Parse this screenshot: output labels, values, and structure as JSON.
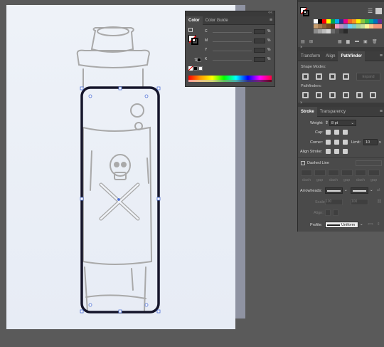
{
  "color_panel": {
    "tabs": [
      "Color",
      "Color Guide"
    ],
    "channels": [
      {
        "label": "C",
        "pct": "%"
      },
      {
        "label": "M",
        "pct": "%"
      },
      {
        "label": "Y",
        "pct": "%"
      },
      {
        "label": "K",
        "pct": "%"
      }
    ]
  },
  "swatches_panel": {
    "colors": [
      "#ffffff",
      "#000000",
      "#ff0000",
      "#ffff00",
      "#00a651",
      "#00aeef",
      "#2e3192",
      "#ec008c",
      "#f26522",
      "#f7941d",
      "#fff200",
      "#8dc63f",
      "#39b54a",
      "#00a99d",
      "#0072bc",
      "#662d91",
      "#c69c6d",
      "#a67c52",
      "#8c6239",
      "#754c24",
      "#603913",
      "#f49ac1",
      "#bd8cbf",
      "#8393ca",
      "#6dcff6",
      "#7accc8",
      "#a3d39c",
      "#c4df9b",
      "#fff799",
      "#fdc68a",
      "#f7977a",
      "#f69679"
    ]
  },
  "align_panel": {
    "tabs": [
      "Transform",
      "Align",
      "Pathfinder"
    ],
    "shape_modes_label": "Shape Modes:",
    "expand_label": "Expand",
    "pathfinders_label": "Pathfinders:"
  },
  "stroke_panel": {
    "tabs": [
      "Stroke",
      "Transparency"
    ],
    "weight_label": "Weight:",
    "weight_value": "8 pt",
    "cap_label": "Cap:",
    "corner_label": "Corner:",
    "limit_label": "Limit:",
    "limit_value": "10",
    "limit_unit": "x",
    "align_stroke_label": "Align Stroke:",
    "dashed_line_label": "Dashed Line",
    "dash_labels": [
      "dash",
      "gap",
      "dash",
      "gap",
      "dash",
      "gap"
    ],
    "arrowheads_label": "Arrowheads:",
    "scale_label": "Scale:",
    "scale_value_1": "100",
    "scale_value_2": "100",
    "align_label": "Align:",
    "profile_label": "Profile:",
    "profile_value": "Uniform"
  }
}
